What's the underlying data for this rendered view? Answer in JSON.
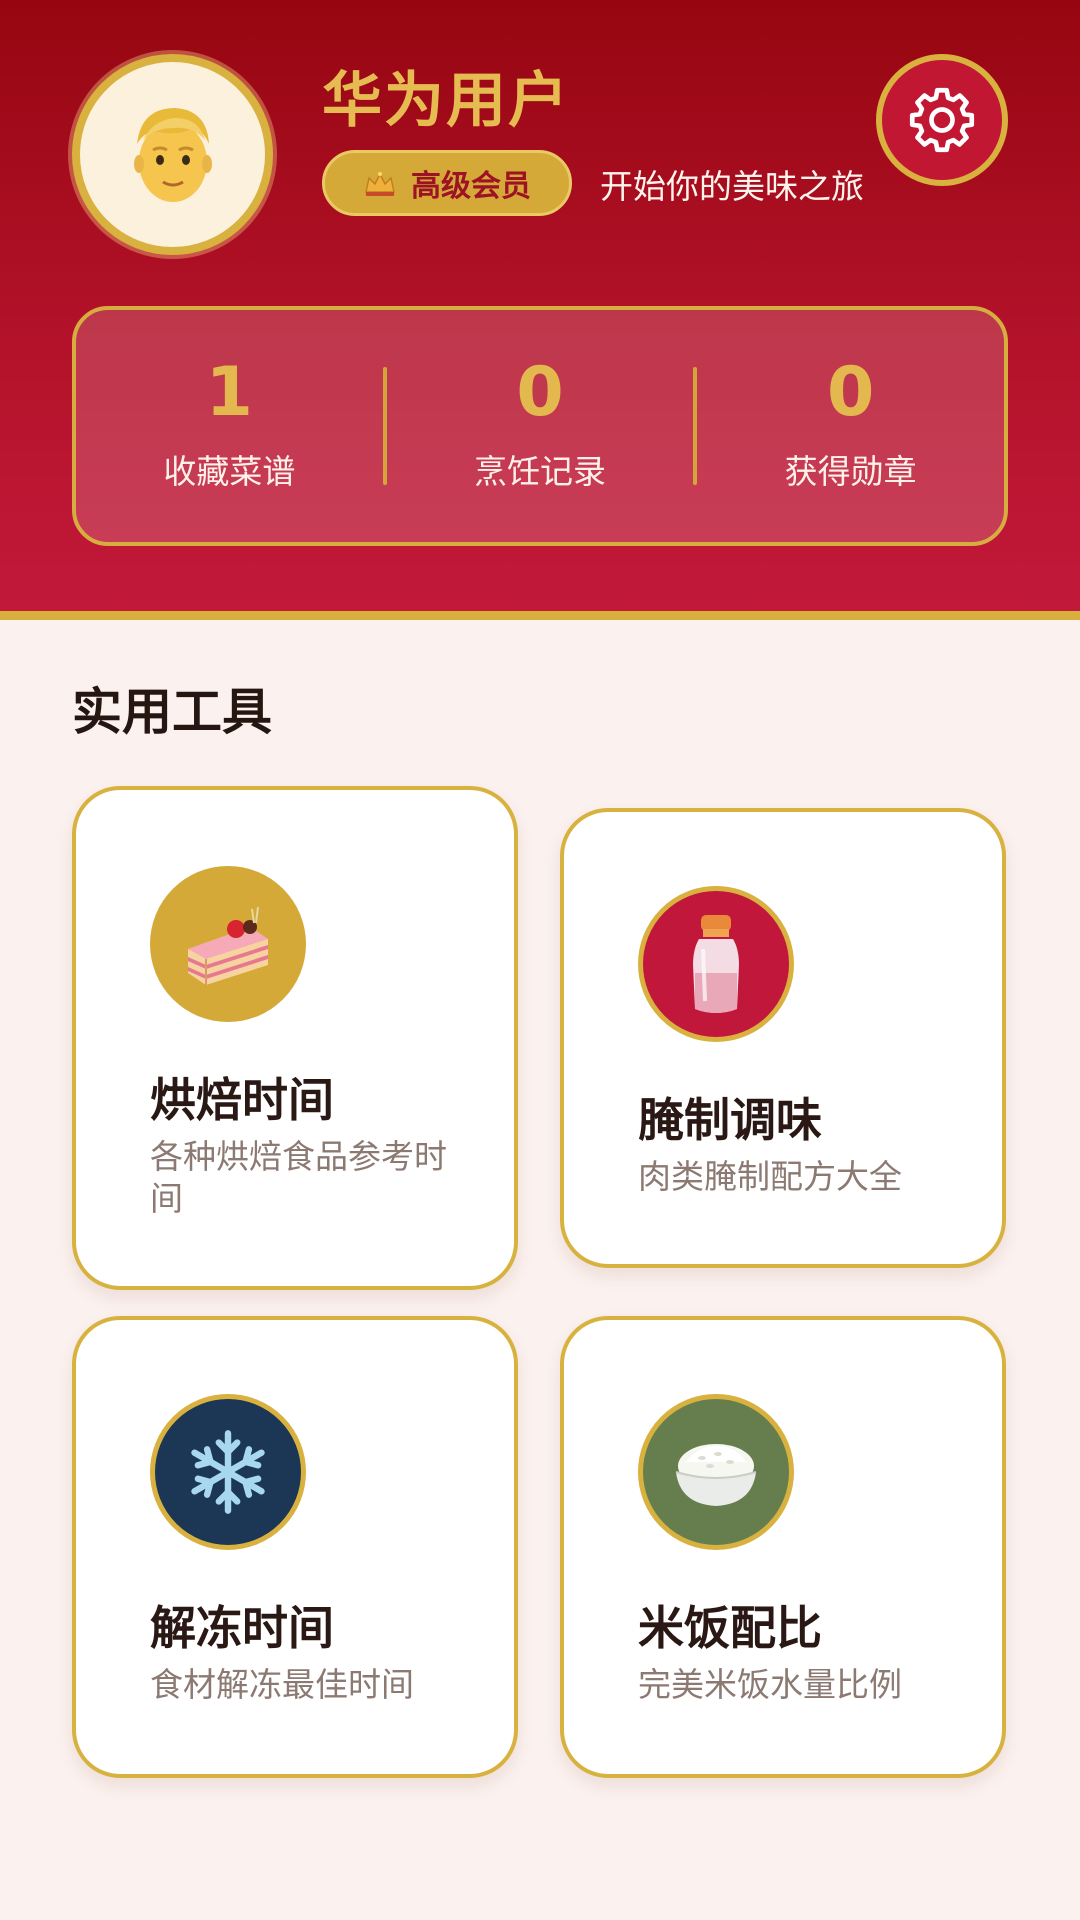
{
  "profile": {
    "username": "华为用户",
    "membership": "高级会员",
    "tagline": "开始你的美味之旅",
    "avatar_icon": "person-avatar-icon"
  },
  "stats": [
    {
      "value": "1",
      "label": "收藏菜谱"
    },
    {
      "value": "0",
      "label": "烹饪记录"
    },
    {
      "value": "0",
      "label": "获得勋章"
    }
  ],
  "tools_section": {
    "title": "实用工具",
    "tools": [
      {
        "title": "烘焙时间",
        "description": "各种烘焙食品参考时间",
        "icon": "cake-icon",
        "circle_color": "#D4A938"
      },
      {
        "title": "腌制调味",
        "description": "肉类腌制配方大全",
        "icon": "salt-shaker-icon",
        "circle_color": "#C0173A"
      },
      {
        "title": "解冻时间",
        "description": "食材解冻最佳时间",
        "icon": "snowflake-icon",
        "circle_color": "#1C3656"
      },
      {
        "title": "米饭配比",
        "description": "完美米饭水量比例",
        "icon": "rice-bowl-icon",
        "circle_color": "#667E4E"
      }
    ]
  },
  "colors": {
    "primary_red": "#B3122A",
    "gold": "#D8AE3C",
    "background": "#FBF1EE"
  }
}
